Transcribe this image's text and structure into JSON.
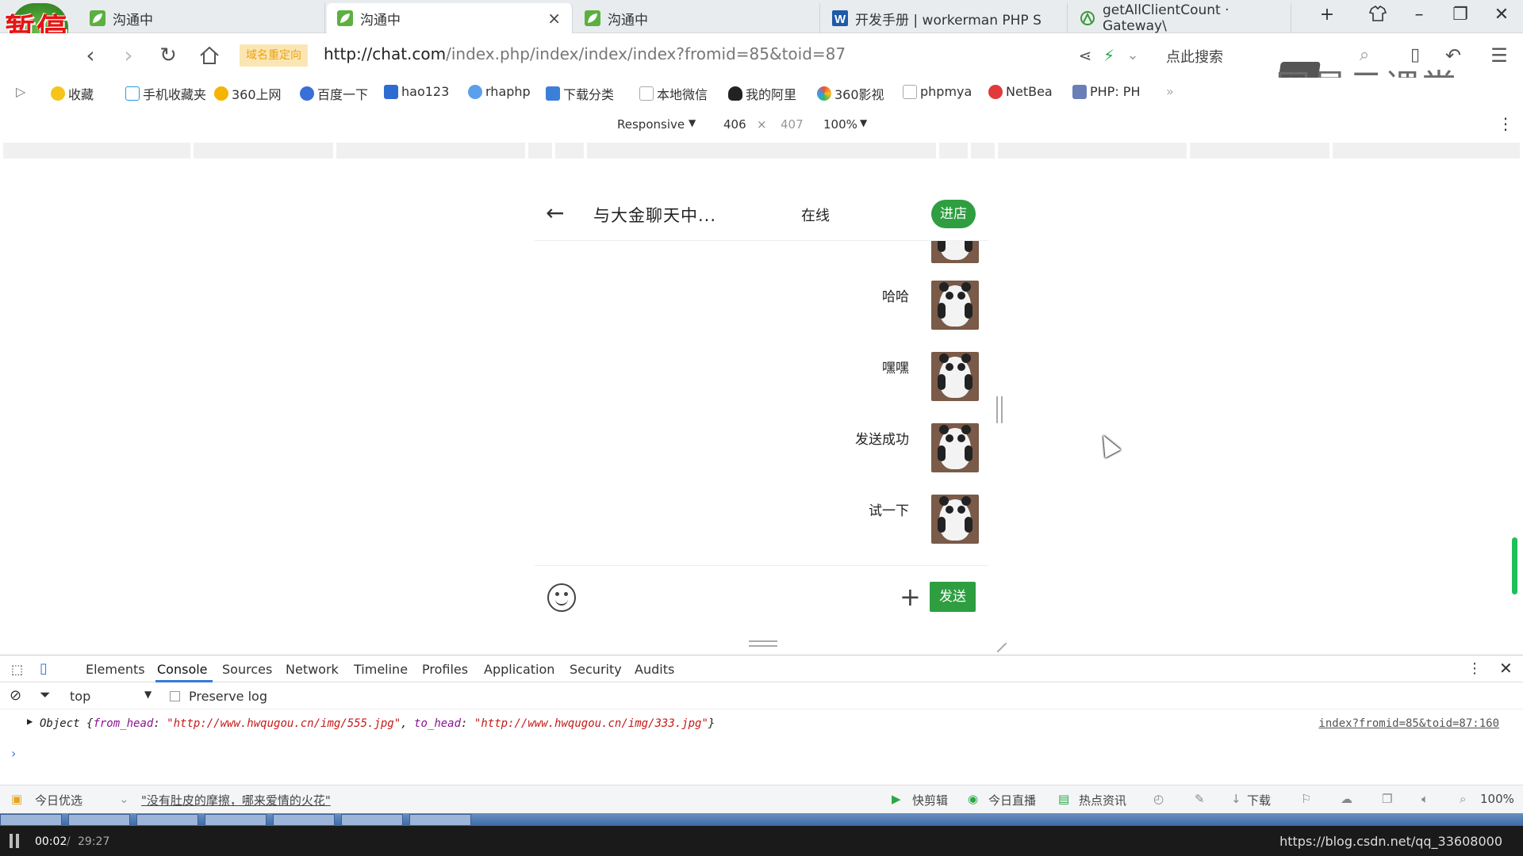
{
  "pause_badge": "暂停",
  "tabs": [
    {
      "label": "沟通中"
    },
    {
      "label": "沟通中"
    },
    {
      "label": "沟通中"
    },
    {
      "label": "开发手册 | workerman PHP S"
    },
    {
      "label": "getAllClientCount · Gateway\\"
    }
  ],
  "address": {
    "badge": "域名重定向",
    "url_host": "http://chat.com",
    "url_path": "/index.php/index/index/index?fromid=85&toid=87",
    "search_label": "点此搜索"
  },
  "watermark": "网易云课堂",
  "bookmarks": [
    "收藏",
    "手机收藏夹",
    "360上网",
    "百度一下",
    "hao123",
    "rhaphp",
    "下载分类",
    "本地微信",
    "我的阿里",
    "360影视",
    "phpmya",
    "NetBea",
    "PHP: PH"
  ],
  "device_toolbar": {
    "mode": "Responsive",
    "width": "406",
    "times": "×",
    "height": "407",
    "zoom": "100%"
  },
  "chat": {
    "title": "与大金聊天中...",
    "status": "在线",
    "enter_shop": "进店",
    "messages": [
      {
        "text": ""
      },
      {
        "text": "哈哈"
      },
      {
        "text": "嘿嘿"
      },
      {
        "text": "发送成功"
      },
      {
        "text": "试一下"
      }
    ],
    "send_label": "发送"
  },
  "devtools": {
    "tabs": [
      "Elements",
      "Console",
      "Sources",
      "Network",
      "Timeline",
      "Profiles",
      "Application",
      "Security",
      "Audits"
    ],
    "context": "top",
    "preserve_log": "Preserve log",
    "log": {
      "prefix": "Object {",
      "key1": "from_head",
      "val1": "\"http://www.hwqugou.cn/img/555.jpg\"",
      "key2": "to_head",
      "val2": "\"http://www.hwqugou.cn/img/333.jpg\"",
      "suffix": "}",
      "source": "index?fromid=85&toid=87:160"
    }
  },
  "status_bar": {
    "today_pick": "今日优选",
    "headline": "\"没有肚皮的摩擦，哪来爱情的火花\"",
    "items": [
      "快剪辑",
      "今日直播",
      "热点资讯",
      "下载"
    ],
    "zoom": "100%"
  },
  "video": {
    "current": "00:02",
    "separator": "/",
    "total": "29:27",
    "blog_url": "https://blog.csdn.net/qq_33608000"
  }
}
